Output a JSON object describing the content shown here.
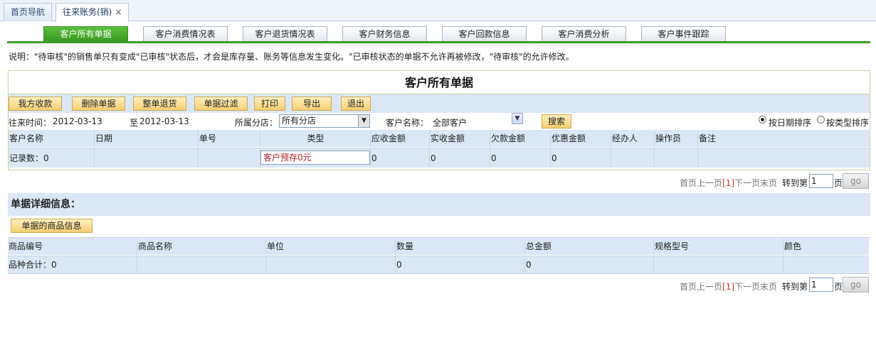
{
  "top_tabs": [
    {
      "label": "首页导航"
    },
    {
      "label": "往来账务(销)",
      "close": "×"
    }
  ],
  "sub_tabs": [
    "客户所有单据",
    "客户消费情况表",
    "客户退货情况表",
    "客户财务信息",
    "客户回款信息",
    "客户消费分析",
    "客户事件跟踪"
  ],
  "notice": "说明：\"待审核\"的销售单只有变成\"已审核\"状态后，才会是库存量、账务等信息发生变化。\"已审核状态的单据不允许再被修改，\"待审核\"的允许修改。",
  "panel": {
    "title": "客户所有单据",
    "buttons": [
      "我方收款",
      "删除单据",
      "整单退货",
      "单据过滤",
      "打印",
      "导出",
      "退出"
    ],
    "filters": {
      "time_label": "往来时间：",
      "date_from": "2012-03-13",
      "to_label": "至",
      "date_to": "2012-03-13",
      "branch_label": "所属分店：",
      "branch_value": "所有分店",
      "customer_label": "客户名称：",
      "customer_value": "全部客户",
      "search_label": "搜索",
      "sort_by_date": "按日期排序",
      "sort_by_type": "按类型排序"
    },
    "columns": [
      "客户名称",
      "日期",
      "单号",
      "类型",
      "应收金额",
      "实收金额",
      "欠款金额",
      "优惠金额",
      "经办人",
      "操作员",
      "备注"
    ],
    "summary": {
      "count_label": "记录数：0",
      "type_value": "客户预存0元",
      "receivable": "0",
      "received": "0",
      "debt": "0",
      "discount": "0"
    }
  },
  "pager": {
    "first": "首页",
    "prev": "上一页",
    "current": "[1]",
    "next": "下一页",
    "last": "末页",
    "jump_label": "转到第",
    "page_value": "1",
    "page_unit": "页",
    "go": "go"
  },
  "detail": {
    "title": "单据详细信息：",
    "goods_button": "单据的商品信息",
    "columns": [
      "商品编号",
      "商品名称",
      "单位",
      "数量",
      "总金额",
      "规格型号",
      "颜色"
    ],
    "summary": {
      "count_label": "品种合计：0",
      "quantity": "0",
      "amount": "0"
    }
  }
}
